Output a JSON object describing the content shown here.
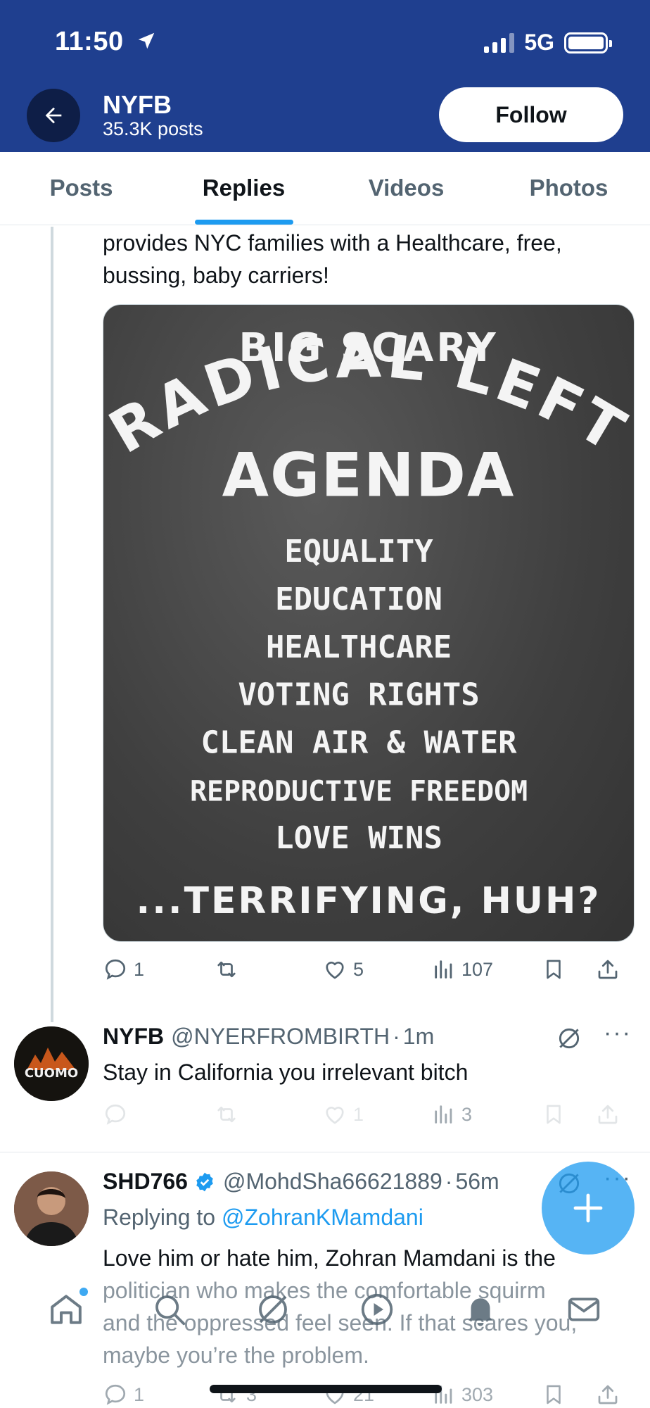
{
  "status_bar": {
    "time": "11:50",
    "network": "5G"
  },
  "header": {
    "account_name": "NYFB",
    "post_count": "35.3K posts",
    "follow_label": "Follow"
  },
  "tabs": [
    {
      "label": "Posts",
      "active": false
    },
    {
      "label": "Replies",
      "active": true
    },
    {
      "label": "Videos",
      "active": false
    },
    {
      "label": "Photos",
      "active": false
    }
  ],
  "tweet1": {
    "text_line1": "provides NYC families with a Healthcare, free,",
    "text_line2": "bussing, baby carriers!",
    "image": {
      "line_top": "BIG SCARY",
      "arc": "RADICAL LEFT",
      "agenda": "AGENDA",
      "items": [
        "EQUALITY",
        "EDUCATION",
        "HEALTHCARE",
        "VOTING RIGHTS",
        "CLEAN AIR & WATER",
        "REPRODUCTIVE FREEDOM",
        "LOVE WINS"
      ],
      "bottom": "...TERRIFYING, HUH?"
    },
    "replies": "1",
    "likes": "5",
    "views": "107"
  },
  "tweet2": {
    "name": "NYFB",
    "handle": "@NYERFROMBIRTH",
    "dot": "·",
    "time": "1m",
    "text": "Stay in California you irrelevant bitch",
    "avatar_text": "CUOMO",
    "likes": "1",
    "views": "3"
  },
  "tweet3": {
    "name": "SHD766",
    "handle": "@MohdSha66621889",
    "dot": "·",
    "time": "56m",
    "replying_prefix": "Replying to ",
    "replying_to": "@ZohranKMamdani",
    "line1": "Love him or hate him, Zohran Mamdani is the",
    "line2": "politician who makes the comfortable squirm",
    "line3": "and the oppressed feel seen. If that scares you,",
    "line4": "maybe you’re the problem.",
    "replies": "1",
    "retweets": "3",
    "likes": "21",
    "views": "303"
  },
  "more_label": "···",
  "icons": {
    "back": "back-arrow-icon",
    "reply": "reply-icon",
    "retweet": "retweet-icon",
    "like": "heart-icon",
    "views": "views-icon",
    "bookmark": "bookmark-icon",
    "share": "share-icon",
    "grok": "grok-icon",
    "verified": "verified-badge-icon",
    "compose": "compose-plus-icon"
  },
  "colors": {
    "header_bg": "#1f3f8f",
    "accent": "#1d9bf0",
    "text": "#0f1419",
    "muted": "#536471"
  }
}
